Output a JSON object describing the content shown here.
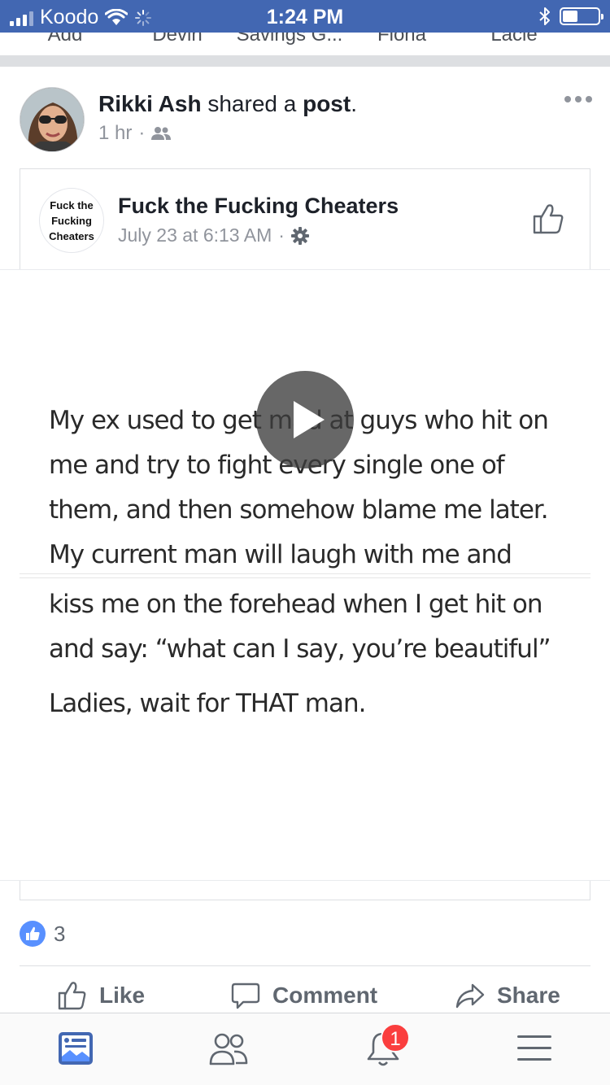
{
  "status_bar": {
    "carrier": "Koodo",
    "time": "1:24 PM"
  },
  "stories_row": {
    "names": [
      "Add",
      "Devin",
      "Savings G...",
      "Fiona",
      "Lacie"
    ]
  },
  "post": {
    "author": "Rikki Ash",
    "action": "shared a",
    "object": "post",
    "punct": ".",
    "time": "1 hr",
    "audience_icon": "friends-icon",
    "more_icon": "more-icon"
  },
  "shared": {
    "page_avatar_lines": [
      "Fuck the",
      "Fucking",
      "Cheaters"
    ],
    "page_name": "Fuck the Fucking Cheaters",
    "timestamp": "July 23 at 6:13 AM",
    "privacy_icon": "gear-icon",
    "like_page_icon": "thumbs-up-outline-icon",
    "video_text": [
      "My ex used to get mad at guys who hit on",
      "me and try to fight every single one of",
      "them, and then somehow blame me later.",
      "My current man will laugh with me and",
      "kiss me on the forehead when I get hit on",
      "and say:  “what can I say, you’re beautiful”",
      "Ladies, wait for THAT man."
    ],
    "play_icon": "play-icon"
  },
  "reactions": {
    "count": "3"
  },
  "actions": {
    "like": "Like",
    "comment": "Comment",
    "share": "Share"
  },
  "tabbar": {
    "notifications_badge": "1"
  },
  "colors": {
    "brand_blue": "#4267b2",
    "like_blue": "#5890ff",
    "badge_red": "#fa3e3e",
    "meta_gray": "#90949c"
  }
}
